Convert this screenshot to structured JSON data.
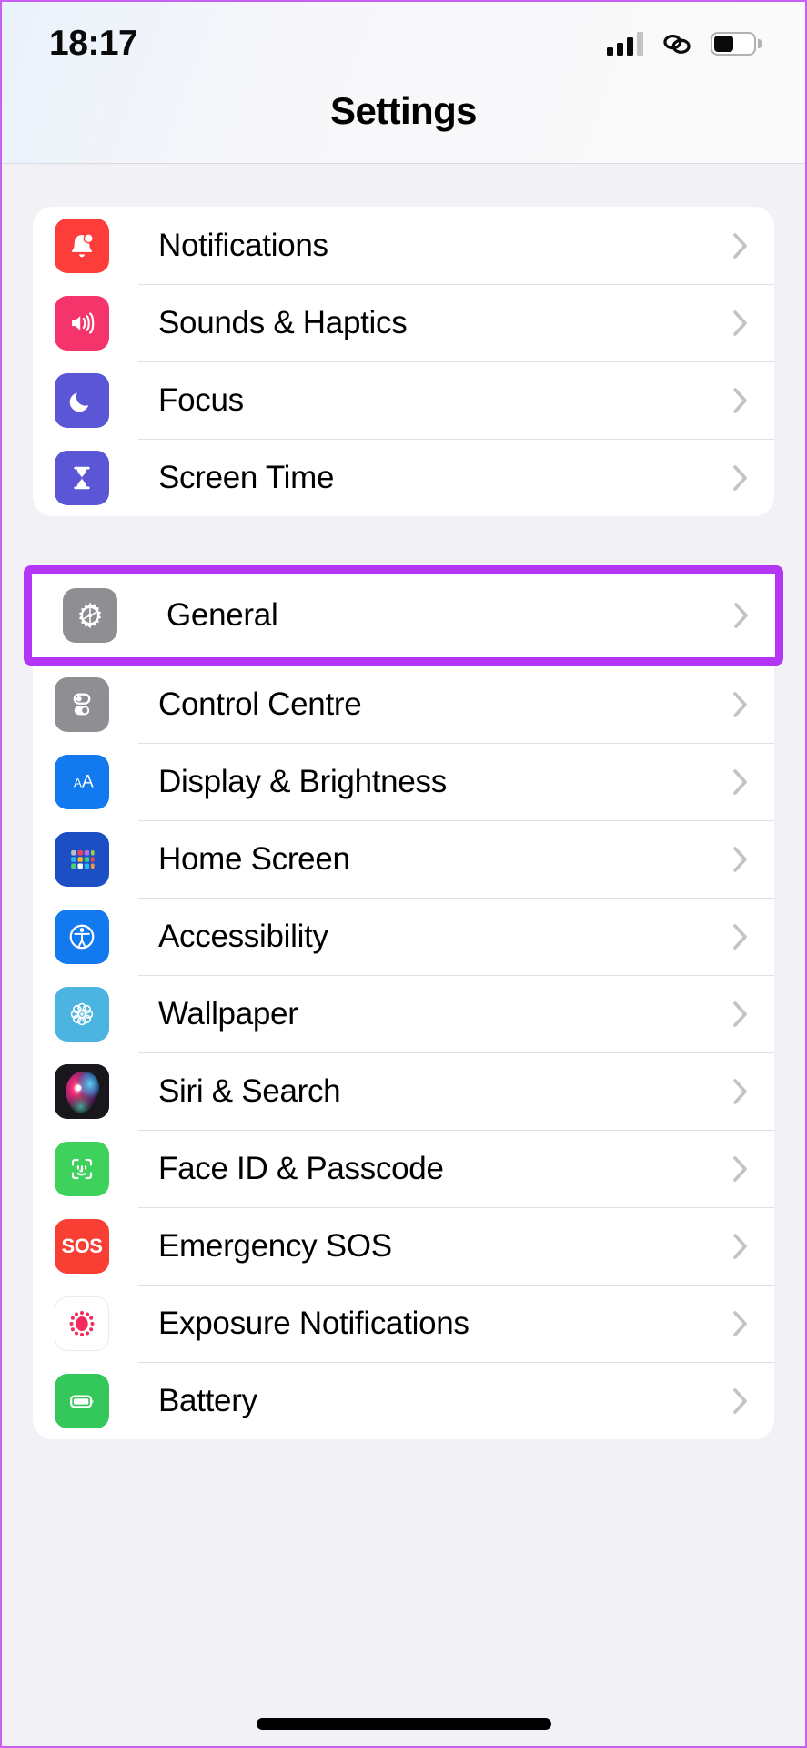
{
  "status_bar": {
    "time": "18:17",
    "signal_icon": "cellular-signal-icon",
    "link_icon": "chain-link-icon",
    "battery_icon": "battery-icon",
    "signal_bars_filled": 3,
    "signal_bars_total": 4,
    "battery_level_percent": 42
  },
  "header": {
    "title": "Settings"
  },
  "highlight": {
    "color": "#b435f5",
    "target": "General"
  },
  "groups": [
    {
      "id": "group-alerts",
      "items": [
        {
          "label": "Notifications",
          "icon": "bell-icon",
          "icon_color": "#fc3d39",
          "chevron": "chevron-right-icon"
        },
        {
          "label": "Sounds & Haptics",
          "icon": "speaker-wave-icon",
          "icon_color": "#f4346a",
          "chevron": "chevron-right-icon"
        },
        {
          "label": "Focus",
          "icon": "moon-icon",
          "icon_color": "#5a56d6",
          "chevron": "chevron-right-icon"
        },
        {
          "label": "Screen Time",
          "icon": "hourglass-icon",
          "icon_color": "#5a56d6",
          "chevron": "chevron-right-icon"
        }
      ]
    },
    {
      "id": "group-system",
      "items": [
        {
          "label": "General",
          "icon": "gear-icon",
          "icon_color": "#8e8e93",
          "chevron": "chevron-right-icon",
          "highlighted": true
        },
        {
          "label": "Control Centre",
          "icon": "control-toggles-icon",
          "icon_color": "#8e8e93",
          "chevron": "chevron-right-icon"
        },
        {
          "label": "Display & Brightness",
          "icon": "text-size-aa-icon",
          "icon_color": "#1279ef",
          "chevron": "chevron-right-icon"
        },
        {
          "label": "Home Screen",
          "icon": "app-grid-icon",
          "icon_color": "#1d4fc4",
          "chevron": "chevron-right-icon"
        },
        {
          "label": "Accessibility",
          "icon": "accessibility-icon",
          "icon_color": "#1279ef",
          "chevron": "chevron-right-icon"
        },
        {
          "label": "Wallpaper",
          "icon": "flower-rosette-icon",
          "icon_color": "#4cb4e0",
          "chevron": "chevron-right-icon"
        },
        {
          "label": "Siri & Search",
          "icon": "siri-orb-icon",
          "icon_color": "#19161c",
          "chevron": "chevron-right-icon"
        },
        {
          "label": "Face ID & Passcode",
          "icon": "face-id-icon",
          "icon_color": "#3ed15b",
          "chevron": "chevron-right-icon"
        },
        {
          "label": "Emergency SOS",
          "icon": "sos-icon",
          "icon_color": "#f93f33",
          "chevron": "chevron-right-icon",
          "icon_text": "SOS"
        },
        {
          "label": "Exposure Notifications",
          "icon": "exposure-dots-icon",
          "icon_color": "#ffffff",
          "chevron": "chevron-right-icon"
        },
        {
          "label": "Battery",
          "icon": "battery-filled-icon",
          "icon_color": "#34c759",
          "chevron": "chevron-right-icon"
        }
      ]
    }
  ],
  "home_indicator": "home-indicator-bar"
}
